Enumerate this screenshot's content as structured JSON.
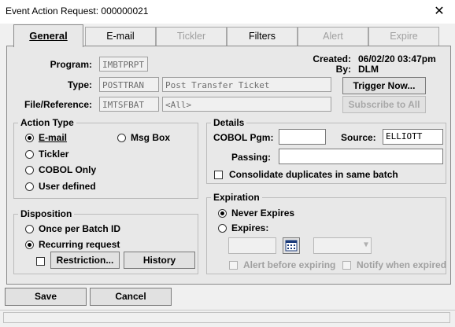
{
  "window": {
    "title": "Event Action Request: 000000021",
    "close_glyph": "✕"
  },
  "tabs": [
    {
      "label": "General",
      "state": "active"
    },
    {
      "label": "E-mail",
      "state": "enabled"
    },
    {
      "label": "Tickler",
      "state": "disabled"
    },
    {
      "label": "Filters",
      "state": "enabled"
    },
    {
      "label": "Alert",
      "state": "disabled"
    },
    {
      "label": "Expire",
      "state": "disabled"
    }
  ],
  "header": {
    "program_label": "Program:",
    "program_value": "IMBTPRPT",
    "type_label": "Type:",
    "type_code": "POSTTRAN",
    "type_desc": "Post Transfer Ticket",
    "file_label": "File/Reference:",
    "file_value": "IMTSFBAT",
    "file_ref": "<All>",
    "created_label": "Created:",
    "created_value": "06/02/20 03:47pm",
    "by_label": "By:",
    "by_value": "DLM",
    "trigger_label": "Trigger Now...",
    "subscribe_label": "Subscribe to All"
  },
  "action_type": {
    "title": "Action Type",
    "options": [
      {
        "label": "E-mail",
        "selected": true
      },
      {
        "label": "Msg Box",
        "selected": false
      },
      {
        "label": "Tickler",
        "selected": false
      },
      {
        "label": "COBOL Only",
        "selected": false
      },
      {
        "label": "User defined",
        "selected": false
      }
    ]
  },
  "disposition": {
    "title": "Disposition",
    "once_label": "Once per Batch ID",
    "recurring_label": "Recurring request",
    "restriction_label": "Restriction...",
    "history_label": "History",
    "selected": "Recurring request"
  },
  "details": {
    "title": "Details",
    "cobol_label": "COBOL Pgm:",
    "cobol_value": "",
    "source_label": "Source:",
    "source_value": "ELLIOTT",
    "passing_label": "Passing:",
    "passing_value": "",
    "consolidate_label": "Consolidate duplicates in same batch"
  },
  "expiration": {
    "title": "Expiration",
    "never_label": "Never Expires",
    "expires_label": "Expires:",
    "selected": "Never Expires",
    "calendar_icon": "calendar-icon",
    "alert_label": "Alert before expiring",
    "notify_label": "Notify when expired"
  },
  "footer": {
    "save_label": "Save",
    "cancel_label": "Cancel"
  }
}
